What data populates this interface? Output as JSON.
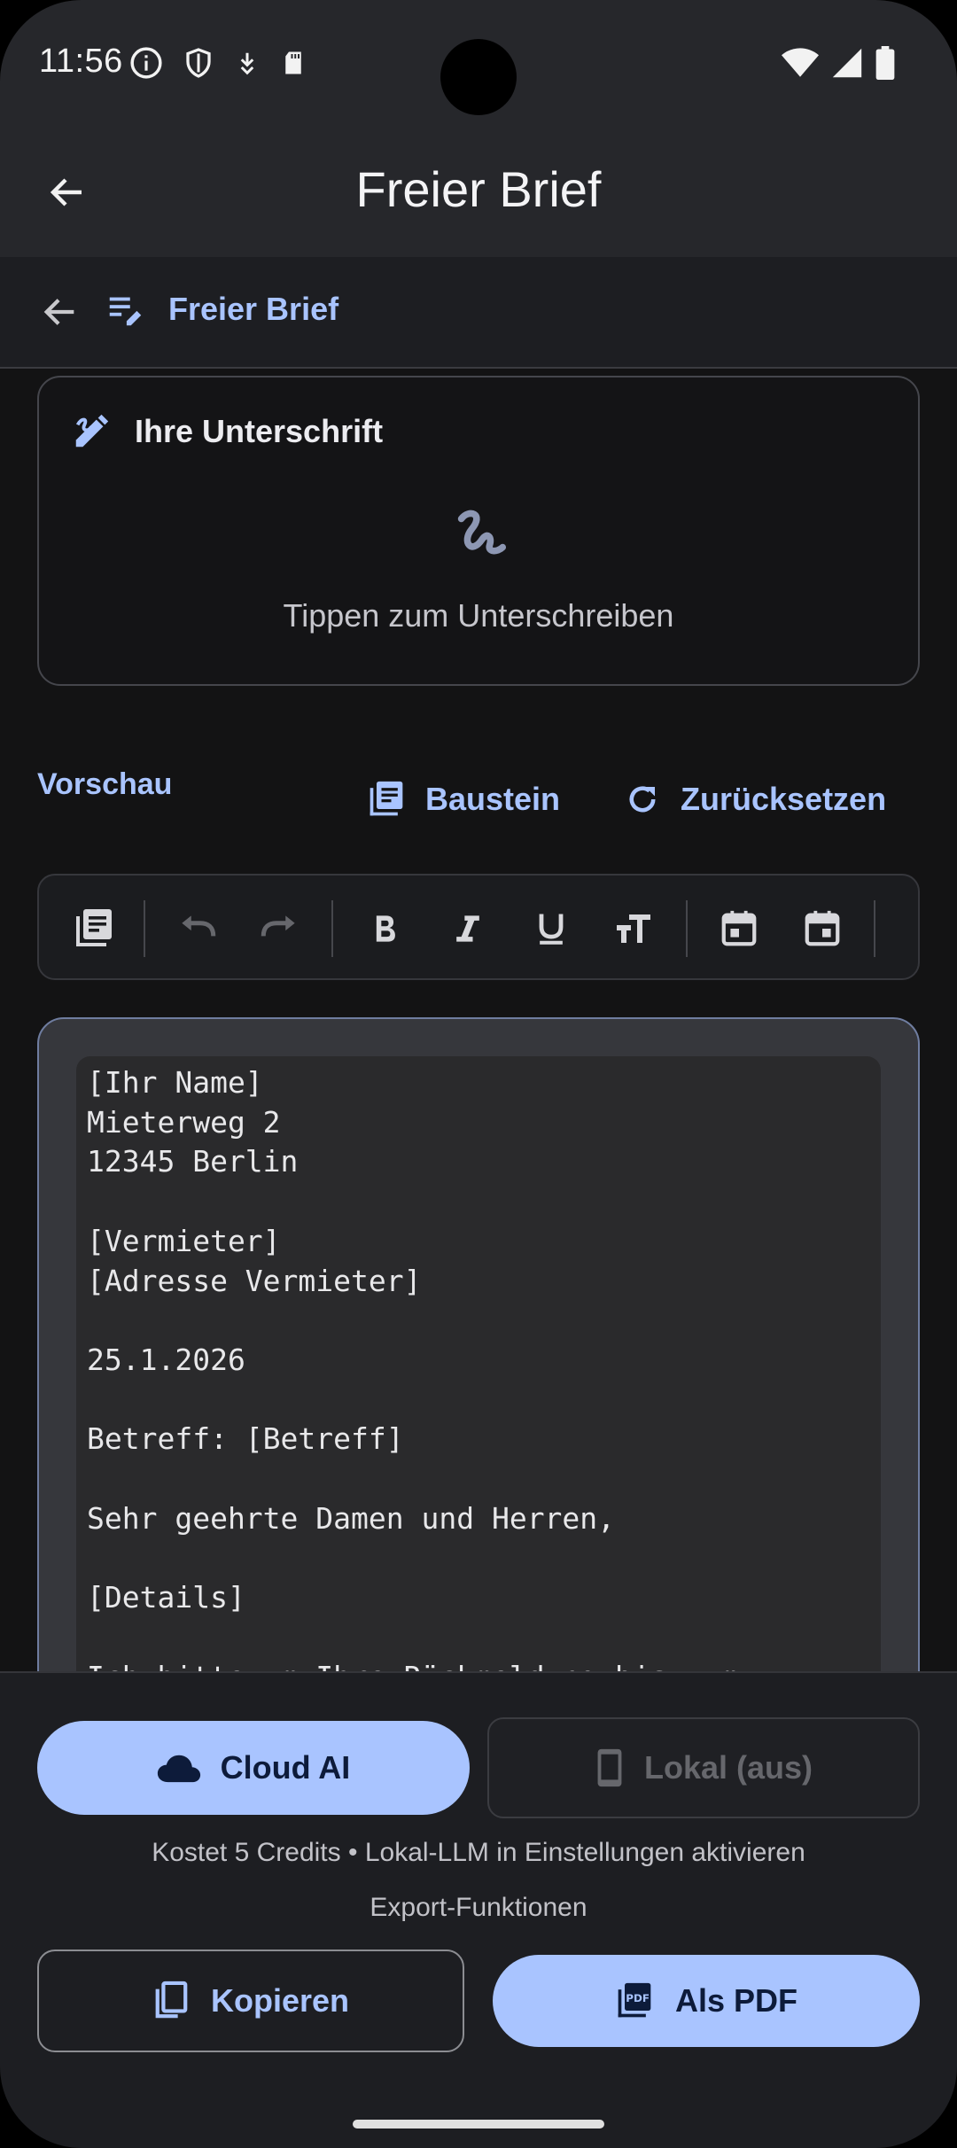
{
  "status_bar": {
    "time": "11:56",
    "icons_left": [
      "info-icon",
      "shield-icon",
      "download-icon",
      "sd-card-icon"
    ],
    "icons_right": [
      "wifi-icon",
      "signal-icon",
      "battery-icon"
    ]
  },
  "app_bar": {
    "title": "Freier Brief"
  },
  "breadcrumb": {
    "label": "Freier Brief",
    "icon": "edit-note-icon"
  },
  "signature": {
    "title": "Ihre Unterschrift",
    "hint": "Tippen zum Unterschreiben"
  },
  "preview": {
    "label": "Vorschau",
    "baustein_label": "Baustein",
    "reset_label": "Zurücksetzen"
  },
  "toolbar": {
    "items": [
      "library-icon",
      "undo-icon",
      "redo-icon",
      "bold-icon",
      "italic-icon",
      "underline-icon",
      "text-size-icon",
      "date-icon",
      "calendar-icon"
    ]
  },
  "editor": {
    "text": "[Ihr Name]\nMieterweg 2\n12345 Berlin\n\n[Vermieter]\n[Adresse Vermieter]\n\n25.1.2026\n\nBetreff: [Betreff]\n\nSehr geehrte Damen und Herren,\n\n[Details]\n\nIch bitte um Ihre Rückmeldung bis zum"
  },
  "bottom": {
    "cloud_label": "Cloud AI",
    "local_label": "Lokal (aus)",
    "credits_note": "Kostet 5 Credits • Lokal-LLM in Einstellungen aktivieren",
    "export_label": "Export-Funktionen",
    "copy_label": "Kopieren",
    "pdf_label": "Als PDF"
  },
  "colors": {
    "accent": "#a9c4ff",
    "background": "#131314",
    "surface": "#1d1e22"
  }
}
